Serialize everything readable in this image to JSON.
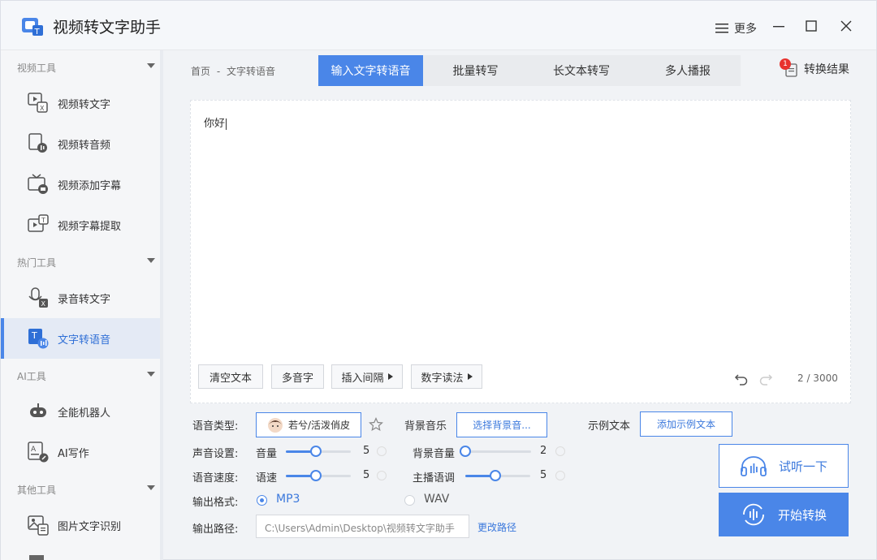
{
  "app": {
    "title": "视频转文字助手",
    "more": "更多"
  },
  "sidebar": {
    "sections": [
      {
        "title": "视频工具",
        "items": [
          "视频转文字",
          "视频转音频",
          "视频添加字幕",
          "视频字幕提取"
        ]
      },
      {
        "title": "热门工具",
        "items": [
          "录音转文字",
          "文字转语音"
        ]
      },
      {
        "title": "AI工具",
        "items": [
          "全能机器人",
          "AI写作"
        ]
      },
      {
        "title": "其他工具",
        "items": [
          "图片文字识别"
        ]
      }
    ],
    "active": "文字转语音"
  },
  "breadcrumb": {
    "home": "首页",
    "sep": "-",
    "current": "文字转语音"
  },
  "tabs": [
    "输入文字转语音",
    "批量转写",
    "长文本转写",
    "多人播报"
  ],
  "result": {
    "label": "转换结果",
    "badge": "1"
  },
  "editor": {
    "text": "你好",
    "count": "2 / 3000"
  },
  "editor_buttons": {
    "clear": "清空文本",
    "polyphone": "多音字",
    "pause": "插入间隔",
    "number": "数字读法"
  },
  "settings": {
    "voice_type_label": "语音类型:",
    "voice_value": "若兮/活泼俏皮",
    "bgm_label": "背景音乐",
    "bgm_button": "选择背景音...",
    "example_label": "示例文本",
    "example_button": "添加示例文本",
    "sound_label": "声音设置:",
    "volume_label": "音量",
    "volume": "5",
    "volume_fraction": 0.45,
    "bg_volume_label": "背景音量",
    "bg_volume": "2",
    "bg_volume_fraction": 0.0,
    "speed_group_label": "语音速度:",
    "speed_label": "语速",
    "speed": "5",
    "speed_fraction": 0.45,
    "pitch_label": "主播语调",
    "pitch": "5",
    "pitch_fraction": 0.45,
    "format_label": "输出格式:",
    "format_mp3": "MP3",
    "format_wav": "WAV",
    "selected_format": "MP3",
    "path_label": "输出路径:",
    "path_value": "C:\\Users\\Admin\\Desktop\\视频转文字助手",
    "change_path": "更改路径"
  },
  "actions": {
    "preview": "试听一下",
    "start": "开始转换"
  },
  "colors": {
    "accent": "#4a86e8",
    "badge": "#e8322e"
  }
}
